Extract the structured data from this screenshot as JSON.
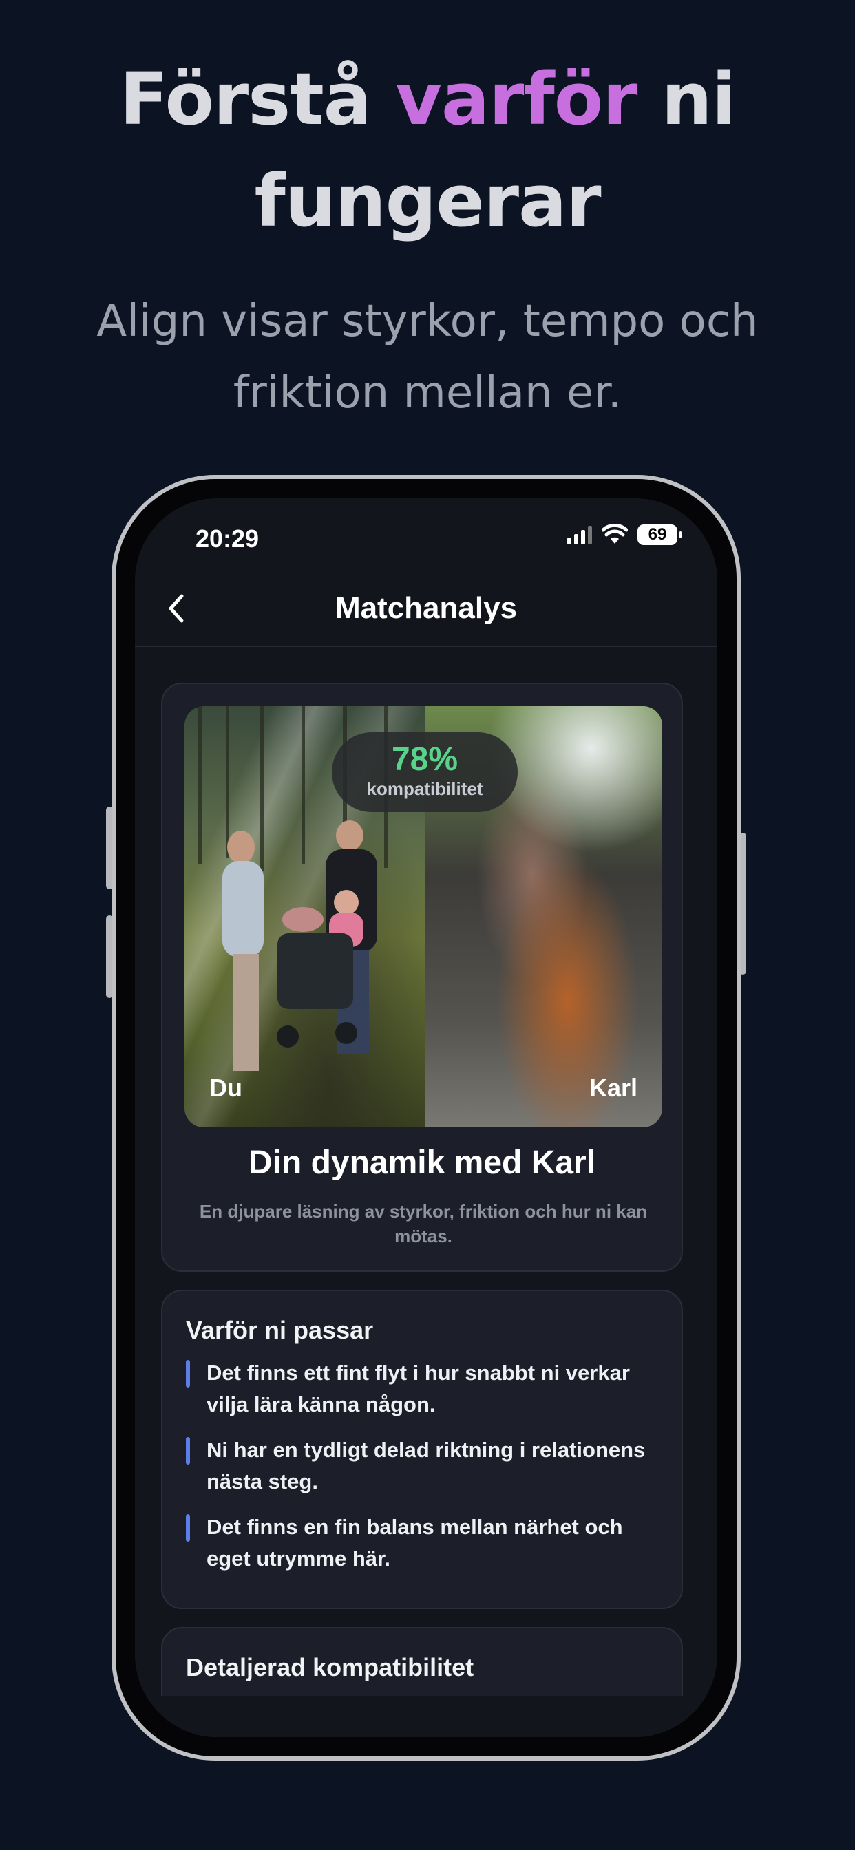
{
  "marketing": {
    "headline_part1": "Förstå ",
    "headline_accent": "varför",
    "headline_part2": " ni fungerar",
    "subheadline": "Align visar styrkor, tempo och friktion mellan er."
  },
  "status_bar": {
    "time": "20:29",
    "battery": "69"
  },
  "nav": {
    "title": "Matchanalys"
  },
  "match_card": {
    "compatibility_value": "78%",
    "compatibility_label": "kompatibilitet",
    "left_name": "Du",
    "right_name": "Karl",
    "title": "Din dynamik med Karl",
    "subtitle": "En djupare läsning av styrkor, friktion och hur ni kan mötas."
  },
  "reasons": {
    "title": "Varför ni passar",
    "items": [
      "Det finns ett fint flyt i hur snabbt ni verkar vilja lära känna någon.",
      "Ni har en tydligt delad riktning i relationens nästa steg.",
      "Det finns en fin balans mellan närhet och eget utrymme här."
    ]
  },
  "details": {
    "title": "Detaljerad kompatibilitet"
  },
  "colors": {
    "accent": "#c86fe0",
    "compat_green": "#59d28a",
    "bullet_blue": "#5b7fe6",
    "background": "#0c1322"
  }
}
